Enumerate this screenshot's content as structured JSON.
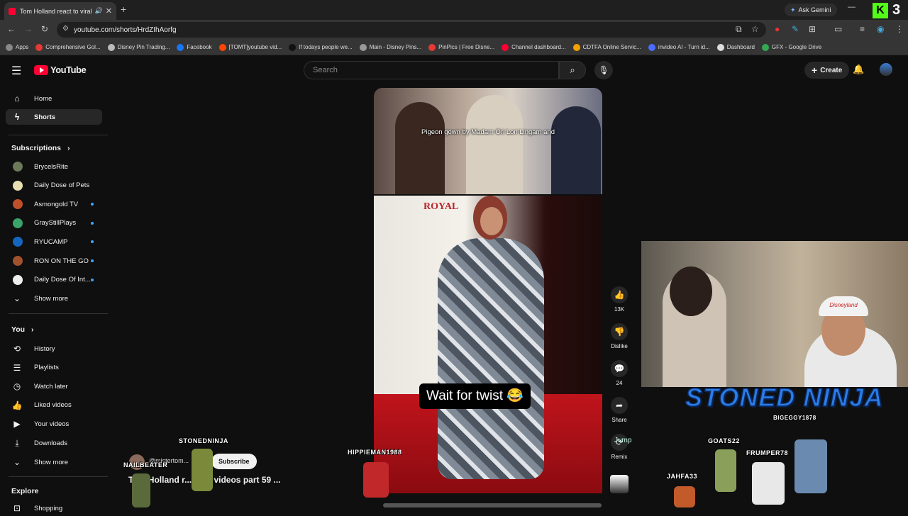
{
  "browser": {
    "tab_title": "Tom Holland react to viral v",
    "url": "youtube.com/shorts/HrdZIhAorfg",
    "ask_gemini": "Ask Gemini",
    "kick_badge": "3",
    "bookmarks": [
      {
        "label": "Apps",
        "color": "#888888"
      },
      {
        "label": "Comprehensive Gol...",
        "color": "#e53935"
      },
      {
        "label": "Disney Pin Trading...",
        "color": "#bbbbbb"
      },
      {
        "label": "Facebook",
        "color": "#1877f2"
      },
      {
        "label": "[TOMT]youtube vid...",
        "color": "#ff4500"
      },
      {
        "label": "If todays people we...",
        "color": "#111111"
      },
      {
        "label": "Main - Disney Pins...",
        "color": "#999999"
      },
      {
        "label": "PinPics | Free Disne...",
        "color": "#e53935"
      },
      {
        "label": "Channel dashboard...",
        "color": "#ff0033"
      },
      {
        "label": "CDTFA Online Servic...",
        "color": "#f4a000"
      },
      {
        "label": "invideo AI - Turn id...",
        "color": "#4a6cff"
      },
      {
        "label": "Dashboard",
        "color": "#dddddd"
      },
      {
        "label": "GFX - Google Drive",
        "color": "#34a853"
      }
    ]
  },
  "youtube": {
    "logo_text": "YouTube",
    "search_placeholder": "Search",
    "create_label": "Create"
  },
  "sidebar": {
    "home": "Home",
    "shorts": "Shorts",
    "subscriptions_heading": "Subscriptions",
    "subscriptions": [
      {
        "label": "BrycelsRite",
        "color": "#6a7a5a",
        "dot": false
      },
      {
        "label": "Daily Dose of Pets",
        "color": "#e8e0b0",
        "dot": false
      },
      {
        "label": "Asmongold TV",
        "color": "#c0502a",
        "dot": true
      },
      {
        "label": "GrayStillPlays",
        "color": "#3aa36a",
        "dot": true
      },
      {
        "label": "RYUCAMP",
        "color": "#1565c0",
        "dot": true
      },
      {
        "label": "RON ON THE GO",
        "color": "#a0522d",
        "dot": true
      },
      {
        "label": "Daily Dose Of Int...",
        "color": "#eeeeee",
        "dot": true
      }
    ],
    "show_more_1": "Show more",
    "you_heading": "You",
    "you_items": [
      {
        "label": "History",
        "icon": "history-icon",
        "glyph": "⟲"
      },
      {
        "label": "Playlists",
        "icon": "playlists-icon",
        "glyph": "☰"
      },
      {
        "label": "Watch later",
        "icon": "clock-icon",
        "glyph": "◷"
      },
      {
        "label": "Liked videos",
        "icon": "thumbs-up-icon",
        "glyph": "👍"
      },
      {
        "label": "Your videos",
        "icon": "video-icon",
        "glyph": "▶"
      },
      {
        "label": "Downloads",
        "icon": "download-icon",
        "glyph": "⤓"
      }
    ],
    "show_more_2": "Show more",
    "explore_heading": "Explore",
    "shopping": "Shopping"
  },
  "short": {
    "top_caption": "Pigeon gown by Madam Ori Lori Lingam and",
    "center_caption": "Wait for twist 😂",
    "backdrop_text": "ROYAL",
    "channel_handle": "@mistertom...",
    "subscribe_label": "Subscribe",
    "title": "Tom Holland r... viral videos part 59 ...",
    "actions": {
      "like_count": "13K",
      "dislike_label": "Dislike",
      "comment_count": "24",
      "share_label": "Share",
      "remix_label": "Remix"
    }
  },
  "stream_overlay": {
    "banner": "STONED NINJA",
    "cap_text": "Disneyland",
    "timer_text": "Jump",
    "nicknames": {
      "stoned_ninja": "STONEDNINJA",
      "nailbeater": "NAILBEATER",
      "hippieman": "HIPPIEMAN1988",
      "biggeggy": "BIGEGGY1878",
      "goats": "GOATS22",
      "frumper": "FRUMPER78",
      "jahfa": "JAHFA33"
    }
  }
}
